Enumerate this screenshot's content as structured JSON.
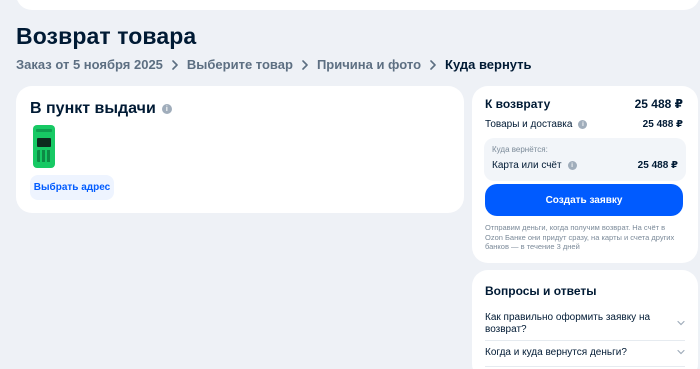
{
  "page": {
    "title": "Возврат товара"
  },
  "breadcrumbs": [
    {
      "label": "Заказ от 5 ноября 2025"
    },
    {
      "label": "Выберите товар"
    },
    {
      "label": "Причина и фото"
    },
    {
      "label": "Куда вернуть"
    }
  ],
  "pickup": {
    "title": "В пункт выдачи",
    "info_icon": "info-icon",
    "product_icon": "product-thumbnail",
    "choose_address_label": "Выбрать адрес"
  },
  "summary": {
    "refund_label": "К возврату",
    "refund_total": "25 488 ₽",
    "goods_label": "Товары и доставка",
    "goods_amount": "25 488 ₽",
    "where_label": "Куда вернётся:",
    "method_label": "Карта или счёт",
    "method_amount": "25 488 ₽",
    "create_label": "Создать заявку",
    "note": "Отправим деньги, когда получим возврат. На счёт в Ozon Банке они придут сразу, на карты и счета других банков — в течение 3 дней"
  },
  "faq": {
    "title": "Вопросы и ответы",
    "items": [
      {
        "question": "Как правильно оформить заявку на возврат?"
      },
      {
        "question": "Когда и куда вернутся деньги?"
      }
    ]
  },
  "colors": {
    "accent": "#005bff",
    "background": "#eef1f6",
    "text": "#001a34",
    "muted": "#5d6f82"
  }
}
